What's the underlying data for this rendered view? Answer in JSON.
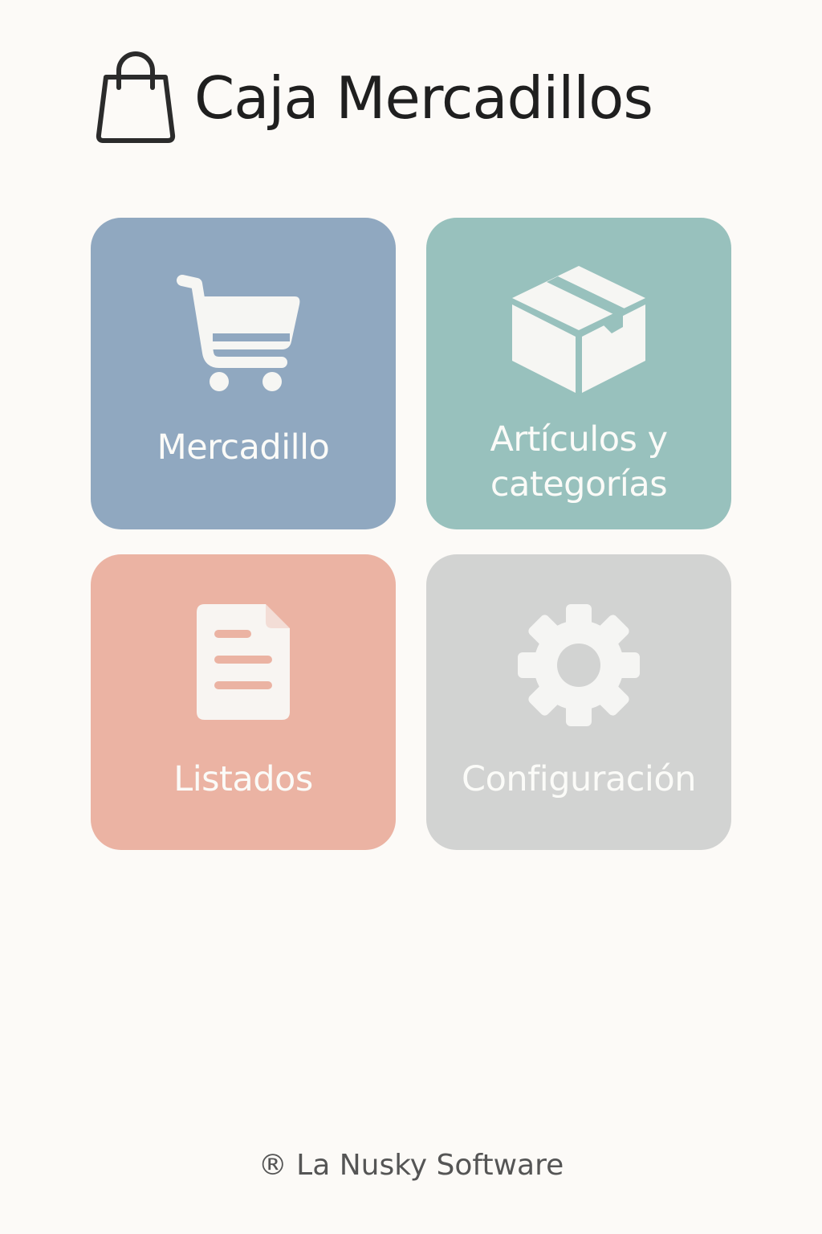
{
  "app": {
    "title": "Caja Mercadillos",
    "icon": "shopping-bag-icon"
  },
  "menu": {
    "tiles": [
      {
        "label": "Mercadillo",
        "icon": "shopping-cart-icon",
        "color": "#90a8c0"
      },
      {
        "label_line1": "Artículos y",
        "label_line2": "categorías",
        "icon": "box-icon",
        "color": "#98c1bd"
      },
      {
        "label": "Listados",
        "icon": "document-icon",
        "color": "#ebb3a3"
      },
      {
        "label": "Configuración",
        "icon": "gear-icon",
        "color": "#d2d3d2"
      }
    ]
  },
  "footer": {
    "text": "® La Nusky Software"
  }
}
